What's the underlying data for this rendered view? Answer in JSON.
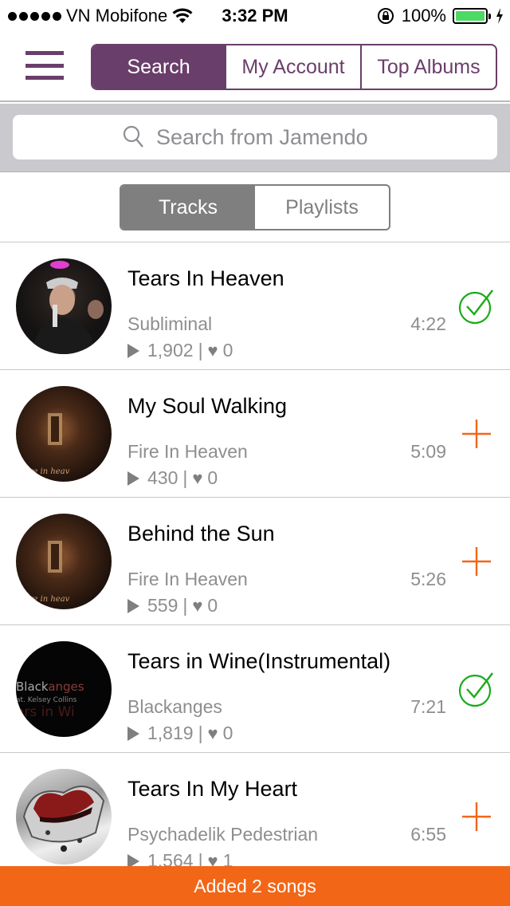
{
  "status_bar": {
    "carrier": "VN Mobifone",
    "time": "3:32 PM",
    "battery": "100%",
    "battery_level": 1.0
  },
  "nav": {
    "tabs": [
      {
        "label": "Search",
        "active": true
      },
      {
        "label": "My Account",
        "active": false
      },
      {
        "label": "Top Albums",
        "active": false
      }
    ],
    "accent_color": "#6a3e6a"
  },
  "search": {
    "placeholder": "Search from Jamendo",
    "value": ""
  },
  "sub_tabs": [
    {
      "label": "Tracks",
      "active": true
    },
    {
      "label": "Playlists",
      "active": false
    }
  ],
  "tracks": [
    {
      "title": "Tears In Heaven",
      "artist": "Subliminal",
      "duration": "4:22",
      "plays": "1,902",
      "likes": "0",
      "status": "added",
      "cover": "performer-photo"
    },
    {
      "title": "My Soul Walking",
      "artist": "Fire In Heaven",
      "duration": "5:09",
      "plays": "430",
      "likes": "0",
      "status": "add",
      "cover": "fire-in-heaven-cover"
    },
    {
      "title": "Behind the Sun",
      "artist": "Fire In Heaven",
      "duration": "5:26",
      "plays": "559",
      "likes": "0",
      "status": "add",
      "cover": "fire-in-heaven-cover"
    },
    {
      "title": "Tears in Wine(Instrumental)",
      "artist": "Blackanges",
      "duration": "7:21",
      "plays": "1,819",
      "likes": "0",
      "status": "added",
      "cover": "blackanges-cover"
    },
    {
      "title": "Tears In My Heart",
      "artist": "Psychadelik Pedestrian",
      "duration": "6:55",
      "plays": "1,564",
      "likes": "1",
      "status": "add",
      "cover": "heart-cup-cover"
    }
  ],
  "colors": {
    "added": "#1aab1a",
    "add": "#f26617",
    "toast": "#f26617"
  },
  "toast": {
    "message": "Added 2 songs"
  }
}
